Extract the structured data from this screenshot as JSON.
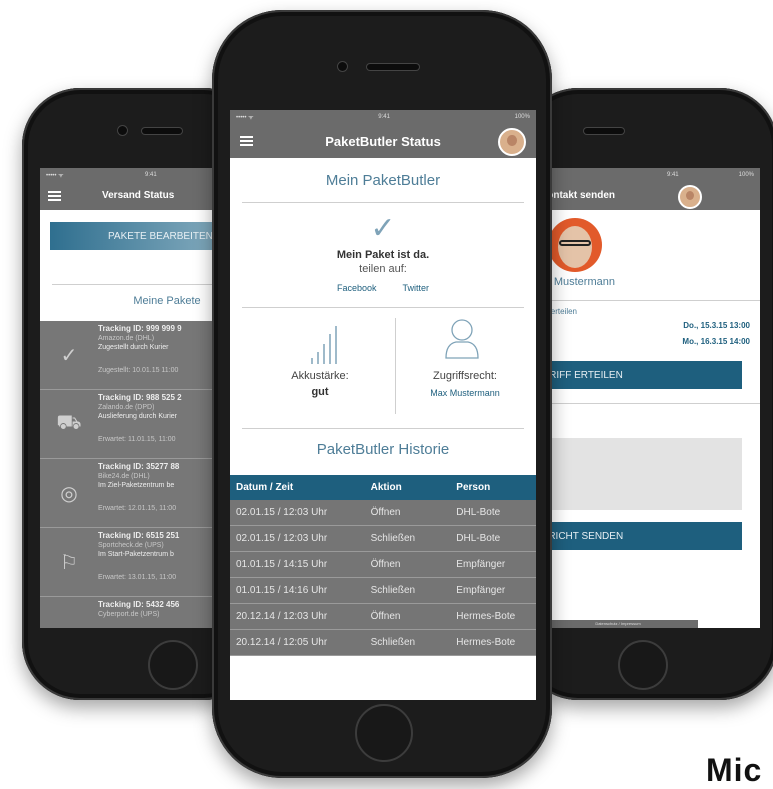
{
  "left": {
    "status": {
      "signal": "••••• ᯤ",
      "time": "9:41"
    },
    "nav_title": "Versand Status",
    "edit_button": "PAKETE BEARBEITEN",
    "section_title": "Meine Pakete",
    "items": [
      {
        "icon": "✓",
        "title": "Tracking ID: 999 999 9",
        "shop": "Amazon.de (DHL)",
        "status": "Zugestellt durch Kurier",
        "footer": "Zugestellt: 10.01.15 11:00"
      },
      {
        "icon": "⛟",
        "title": "Tracking ID: 988 525 2",
        "shop": "Zalando.de (DPD)",
        "status": "Auslieferung durch Kurier",
        "footer": "Erwartet: 11.01.15, 11:00"
      },
      {
        "icon": "◎",
        "title": "Tracking ID: 35277 88",
        "shop": "Bike24.de (DHL)",
        "status": "Im Ziel-Paketzentrum be",
        "footer": "Erwartet: 12.01.15, 11:00"
      },
      {
        "icon": "⚐",
        "title": "Tracking ID: 6515 251",
        "shop": "Sportcheck.de (UPS)",
        "status": "Im Start-Paketzentrum b",
        "footer": "Erwartet: 13.01.15, 11:00"
      },
      {
        "icon": "▭",
        "title": "Tracking ID: 5432 456",
        "shop": "Cyberport.de (UPS)",
        "status": "",
        "footer": ""
      }
    ]
  },
  "center": {
    "status": {
      "signal": "••••• ᯤ",
      "time": "9:41",
      "battery": "100%"
    },
    "nav_title": "PaketButler Status",
    "section1_title": "Mein PaketButler",
    "check_icon": "✓",
    "paket_text": "Mein Paket ist da.",
    "share_text": "teilen auf:",
    "facebook": "Facebook",
    "twitter": "Twitter",
    "akku_label": "Akkustärke:",
    "akku_value": "gut",
    "zugriff_label": "Zugriffsrecht:",
    "zugriff_value": "Max Mustermann",
    "history_title": "PaketButler Historie",
    "table_headers": [
      "Datum / Zeit",
      "Aktion",
      "Person"
    ],
    "rows": [
      [
        "02.01.15 / 12:03 Uhr",
        "Öffnen",
        "DHL-Bote"
      ],
      [
        "02.01.15 / 12:03 Uhr",
        "Schließen",
        "DHL-Bote"
      ],
      [
        "01.01.15 / 14:15 Uhr",
        "Öffnen",
        "Empfänger"
      ],
      [
        "01.01.15 / 14:16 Uhr",
        "Schließen",
        "Empfänger"
      ],
      [
        "20.12.14 / 12:03 Uhr",
        "Öffnen",
        "Hermes-Bote"
      ],
      [
        "20.12.14 / 12:05 Uhr",
        "Schließen",
        "Hermes-Bote"
      ]
    ]
  },
  "right": {
    "status": {
      "time": "9:41",
      "battery": "100%"
    },
    "nav_title": "Kontakt senden",
    "name": "Max Mustermann",
    "access_label": "Zugriff erteilen",
    "date1": "Do., 15.3.15 13:00",
    "date2": "Mo., 16.3.15 14:00",
    "grant_button": "ZUGRIFF ERTEILEN",
    "message_label": "Nachricht",
    "send_button": "NACHRICHT SENDEN",
    "footer": "Datenschutz / Impressum"
  },
  "corner_text": "Mic"
}
